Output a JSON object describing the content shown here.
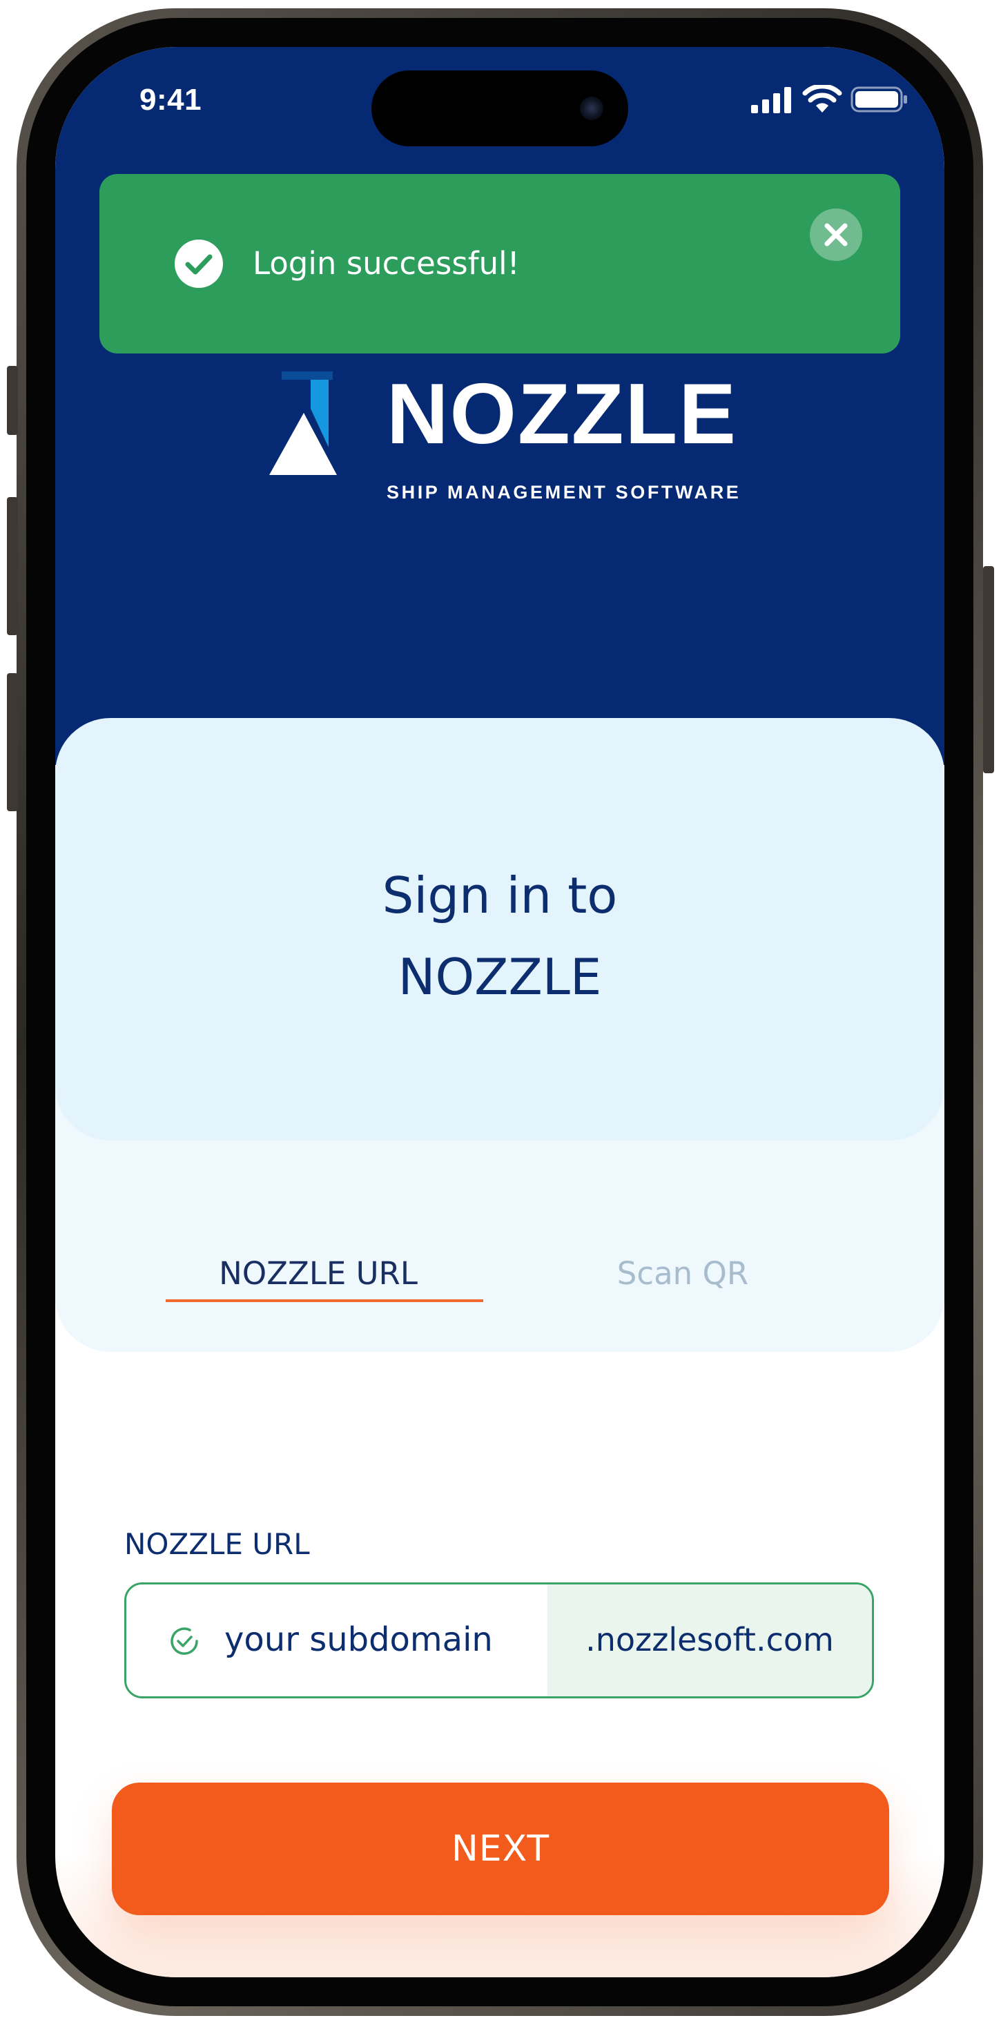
{
  "status_bar": {
    "time": "9:41",
    "icons": [
      "cellular-signal-icon",
      "wifi-icon",
      "battery-icon"
    ]
  },
  "toast": {
    "message": "Login successful!",
    "type": "success",
    "icon": "check-circle-icon",
    "close_icon": "close-icon",
    "color": "#2d9d5c"
  },
  "brand": {
    "name": "NOZZLE",
    "tagline": "SHIP MANAGEMENT SOFTWARE",
    "primary_color": "#052a73",
    "accent_color": "#f35b1d"
  },
  "signin": {
    "title_line1": "Sign in to",
    "title_line2": "NOZZLE"
  },
  "tabs": [
    {
      "label": "NOZZLE URL",
      "active": true
    },
    {
      "label": "Scan QR",
      "active": false
    }
  ],
  "form": {
    "field_label": "NOZZLE URL",
    "url_value": "your subdomain",
    "url_suffix": ".nozzlesoft.com",
    "valid": true
  },
  "actions": {
    "next_label": "NEXT"
  }
}
